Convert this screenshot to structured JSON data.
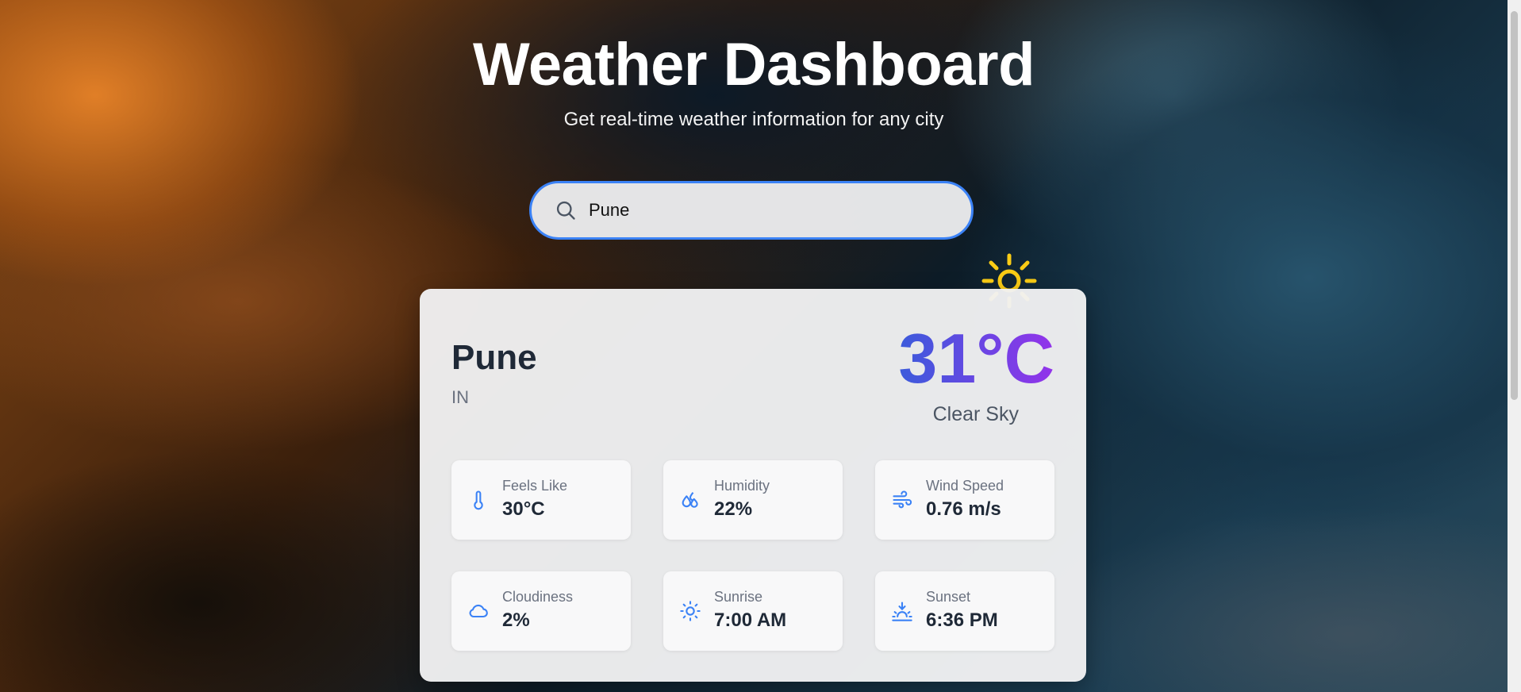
{
  "header": {
    "title": "Weather Dashboard",
    "subtitle": "Get real-time weather information for any city"
  },
  "search": {
    "value": "Pune",
    "icon": "search-icon"
  },
  "weather": {
    "city": "Pune",
    "country": "IN",
    "temperature": "31°C",
    "condition": "Clear Sky",
    "icon": "sun-icon"
  },
  "stats": [
    {
      "label": "Feels Like",
      "value": "30°C",
      "icon": "thermometer-icon"
    },
    {
      "label": "Humidity",
      "value": "22%",
      "icon": "droplets-icon"
    },
    {
      "label": "Wind Speed",
      "value": "0.76 m/s",
      "icon": "wind-icon"
    },
    {
      "label": "Cloudiness",
      "value": "2%",
      "icon": "cloud-icon"
    },
    {
      "label": "Sunrise",
      "value": "7:00 AM",
      "icon": "sunrise-icon"
    },
    {
      "label": "Sunset",
      "value": "6:36 PM",
      "icon": "sunset-icon"
    }
  ],
  "colors": {
    "accent": "#3b82f6",
    "temp_gradient_start": "#3b5bdb",
    "temp_gradient_end": "#9333ea",
    "sun": "#facc15"
  }
}
